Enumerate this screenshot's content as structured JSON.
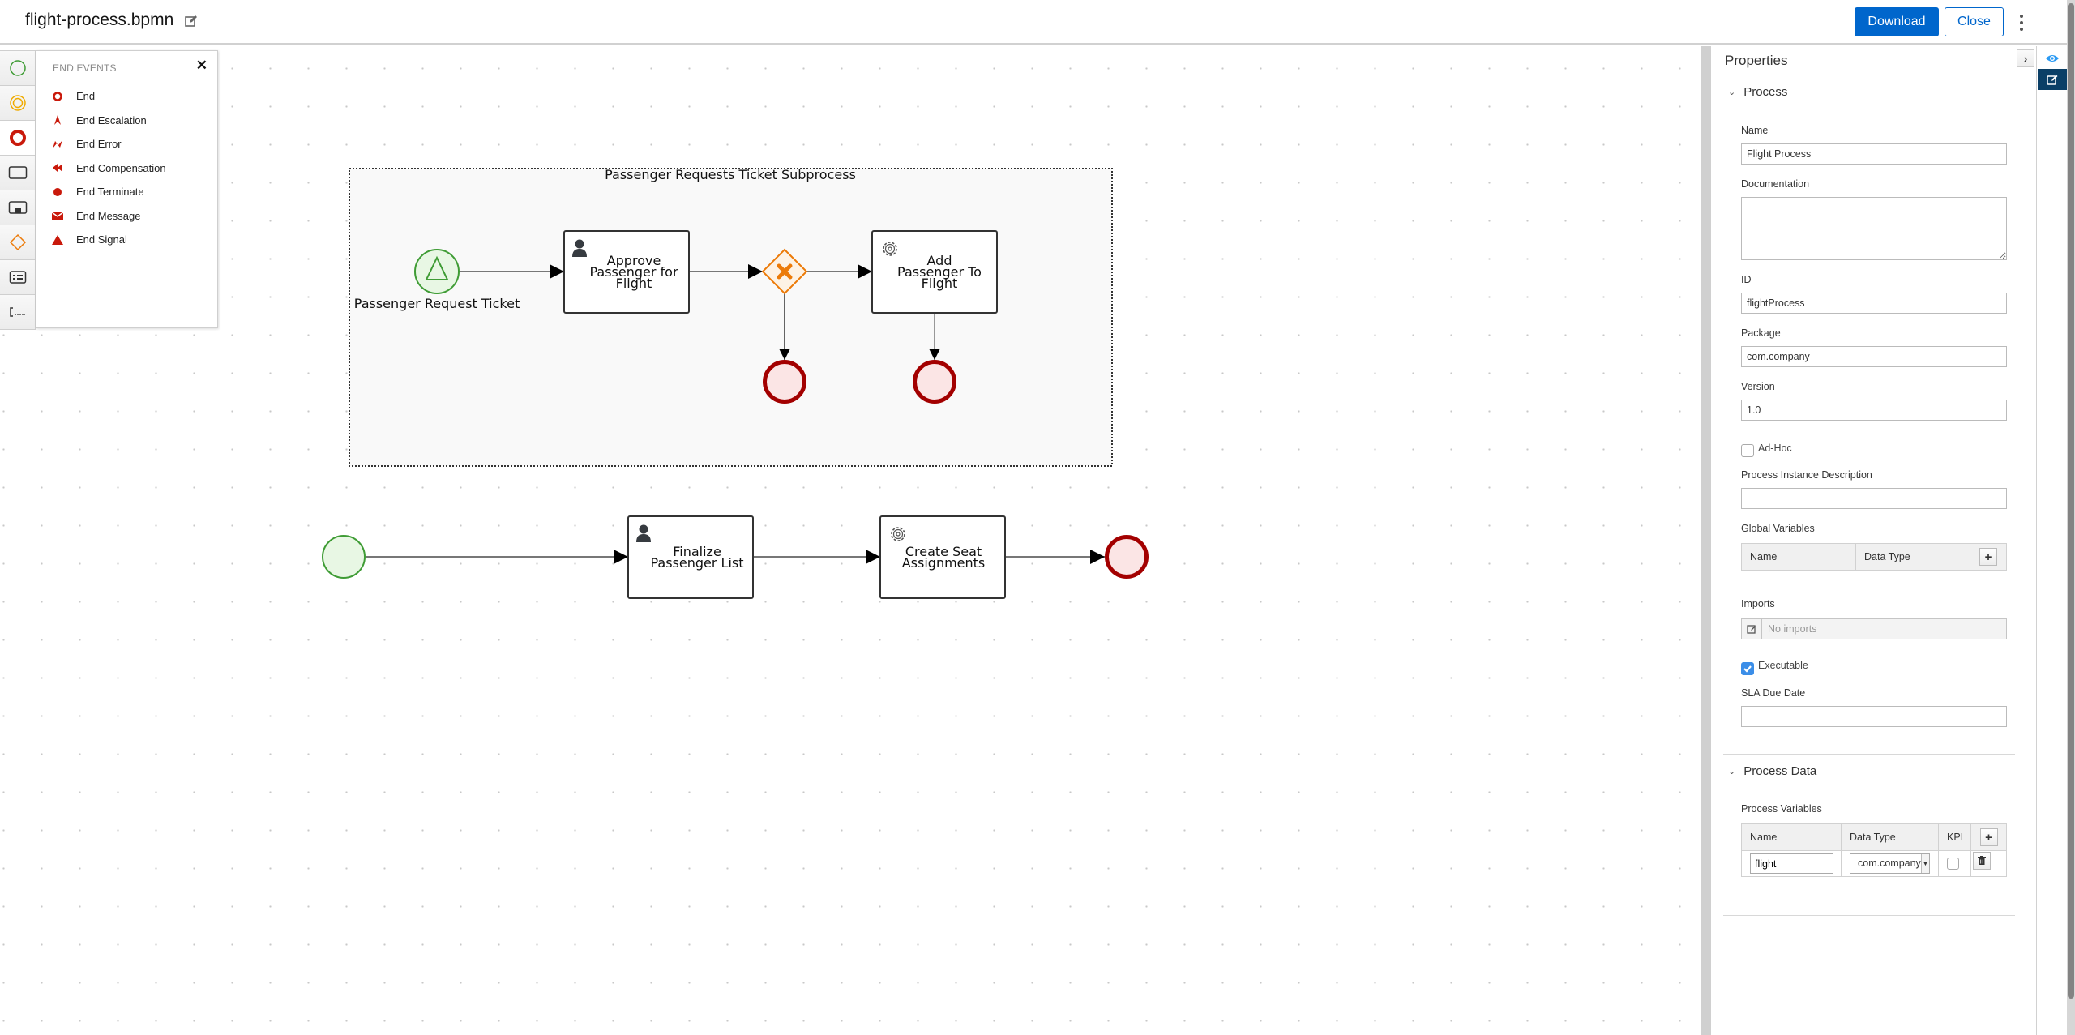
{
  "header": {
    "file_name": "flight-process.bpmn",
    "download_label": "Download",
    "close_label": "Close"
  },
  "palette": {
    "items": [
      {
        "name": "start-events",
        "icon": "start-event-circle",
        "color": "#3f9c35"
      },
      {
        "name": "intermediate-events",
        "icon": "intermediate-event-double-circle",
        "color": "#f0ab00"
      },
      {
        "name": "end-events",
        "icon": "end-event-thick-circle",
        "color": "#c9190b",
        "active": true
      },
      {
        "name": "activities",
        "icon": "task-rectangle"
      },
      {
        "name": "subprocesses",
        "icon": "subprocess-rectangle"
      },
      {
        "name": "gateways",
        "icon": "gateway-diamond",
        "color": "#ec7a08"
      },
      {
        "name": "containers",
        "icon": "lane-icon"
      },
      {
        "name": "artifacts",
        "icon": "annotation-icon"
      }
    ],
    "flyout": {
      "title": "END EVENTS",
      "items": [
        {
          "label": "End",
          "icon": "end-circle-icon"
        },
        {
          "label": "End Escalation",
          "icon": "escalation-icon"
        },
        {
          "label": "End Error",
          "icon": "error-icon"
        },
        {
          "label": "End Compensation",
          "icon": "compensation-icon"
        },
        {
          "label": "End Terminate",
          "icon": "terminate-icon"
        },
        {
          "label": "End Message",
          "icon": "message-icon"
        },
        {
          "label": "End Signal",
          "icon": "signal-icon"
        }
      ]
    }
  },
  "diagram": {
    "subprocess": {
      "label": "Passenger Requests Ticket Subprocess",
      "start_event_label": "Passenger Request Ticket",
      "task1": {
        "lines": [
          "Approve",
          "Passenger for",
          "Flight"
        ],
        "type": "user-task"
      },
      "task2": {
        "lines": [
          "Add",
          "Passenger To",
          "Flight"
        ],
        "type": "service-task"
      },
      "gateway": "exclusive-gateway"
    },
    "main_flow": {
      "task3": {
        "lines": [
          "Finalize",
          "Passenger List"
        ],
        "type": "user-task"
      },
      "task4": {
        "lines": [
          "Create Seat",
          "Assignments"
        ],
        "type": "service-task"
      }
    },
    "colors": {
      "start_stroke": "#3f9c35",
      "start_fill": "#e8f7e4",
      "end_stroke": "#a30000",
      "end_fill": "#fbe5e5",
      "gateway_stroke": "#ec7a08",
      "gateway_fill": "#fdf2e5"
    }
  },
  "properties": {
    "title": "Properties",
    "process_section": {
      "title": "Process",
      "name_label": "Name",
      "name_value": "Flight Process",
      "documentation_label": "Documentation",
      "documentation_value": "",
      "id_label": "ID",
      "id_value": "flightProcess",
      "package_label": "Package",
      "package_value": "com.company",
      "version_label": "Version",
      "version_value": "1.0",
      "adhoc_label": "Ad-Hoc",
      "adhoc_checked": false,
      "instance_desc_label": "Process Instance Description",
      "instance_desc_value": "",
      "global_vars_label": "Global Variables",
      "global_vars_headers": [
        "Name",
        "Data Type"
      ],
      "imports_label": "Imports",
      "imports_placeholder": "No imports",
      "executable_label": "Executable",
      "executable_checked": true,
      "sla_label": "SLA Due Date",
      "sla_value": ""
    },
    "process_data_section": {
      "title": "Process Data",
      "vars_label": "Process Variables",
      "headers": [
        "Name",
        "Data Type",
        "KPI"
      ],
      "rows": [
        {
          "name": "flight",
          "data_type": "com.company",
          "kpi": false
        }
      ]
    }
  }
}
